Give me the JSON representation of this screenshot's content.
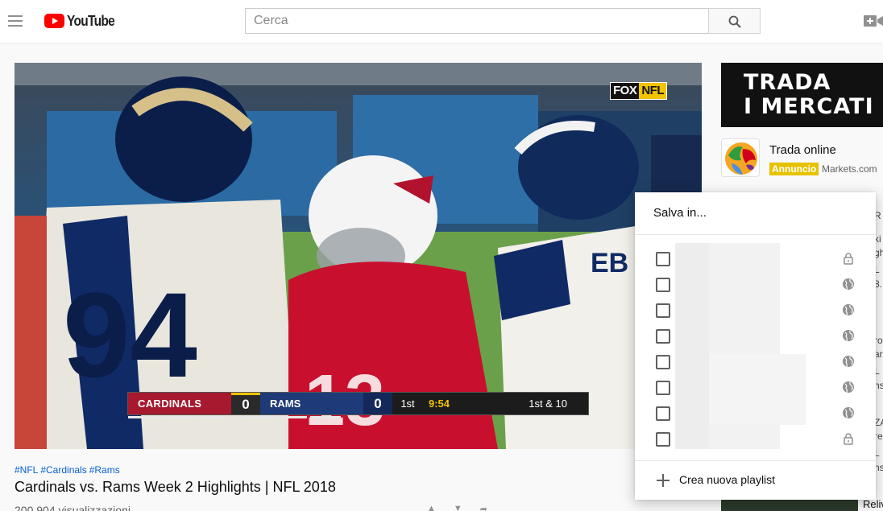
{
  "header": {
    "logo_text": "YouTube",
    "search_placeholder": "Cerca"
  },
  "video": {
    "network_badge": {
      "left": "FOX",
      "right": "NFL"
    },
    "scoreboard": {
      "team1": "CARDINALS",
      "score1": "0",
      "team2": "RAMS",
      "score2": "0",
      "quarter": "1st",
      "clock": "9:54",
      "down_distance": "1st & 10"
    },
    "hashtags": [
      "#NFL",
      "#Cardinals",
      "#Rams"
    ],
    "title": "Cardinals vs. Rams Week 2 Highlights | NFL 2018",
    "views": "200.904 visualizzazioni"
  },
  "sidebar": {
    "ad_banner_lines": [
      "TRADA",
      "I MERCATI"
    ],
    "ad_title": "Trada online",
    "ad_badge": "Annuncio",
    "ad_domain": "Markets.com",
    "related_peek": {
      "fragments": [
        "R",
        "ki",
        "gh",
        "L",
        "8.",
        "ro",
        "ar",
        "L",
        "ns",
        "ZA",
        "re",
        "L",
        "ns"
      ],
      "last_title": "Reliv"
    }
  },
  "save_dialog": {
    "title": "Salva in...",
    "playlists": [
      {
        "privacy": "private",
        "icon": "lock-icon"
      },
      {
        "privacy": "public",
        "icon": "globe-icon"
      },
      {
        "privacy": "public",
        "icon": "globe-icon"
      },
      {
        "privacy": "public",
        "icon": "globe-icon"
      },
      {
        "privacy": "public",
        "icon": "globe-icon"
      },
      {
        "privacy": "public",
        "icon": "globe-icon"
      },
      {
        "privacy": "public",
        "icon": "globe-icon"
      },
      {
        "privacy": "private",
        "icon": "lock-icon"
      }
    ],
    "create_label": "Crea nuova playlist"
  },
  "colors": {
    "brand_red": "#ff0000",
    "link_blue": "#065fd4",
    "ad_badge": "#e6c200",
    "cardinals_red": "#a6192e",
    "rams_blue": "#1e3a78"
  }
}
